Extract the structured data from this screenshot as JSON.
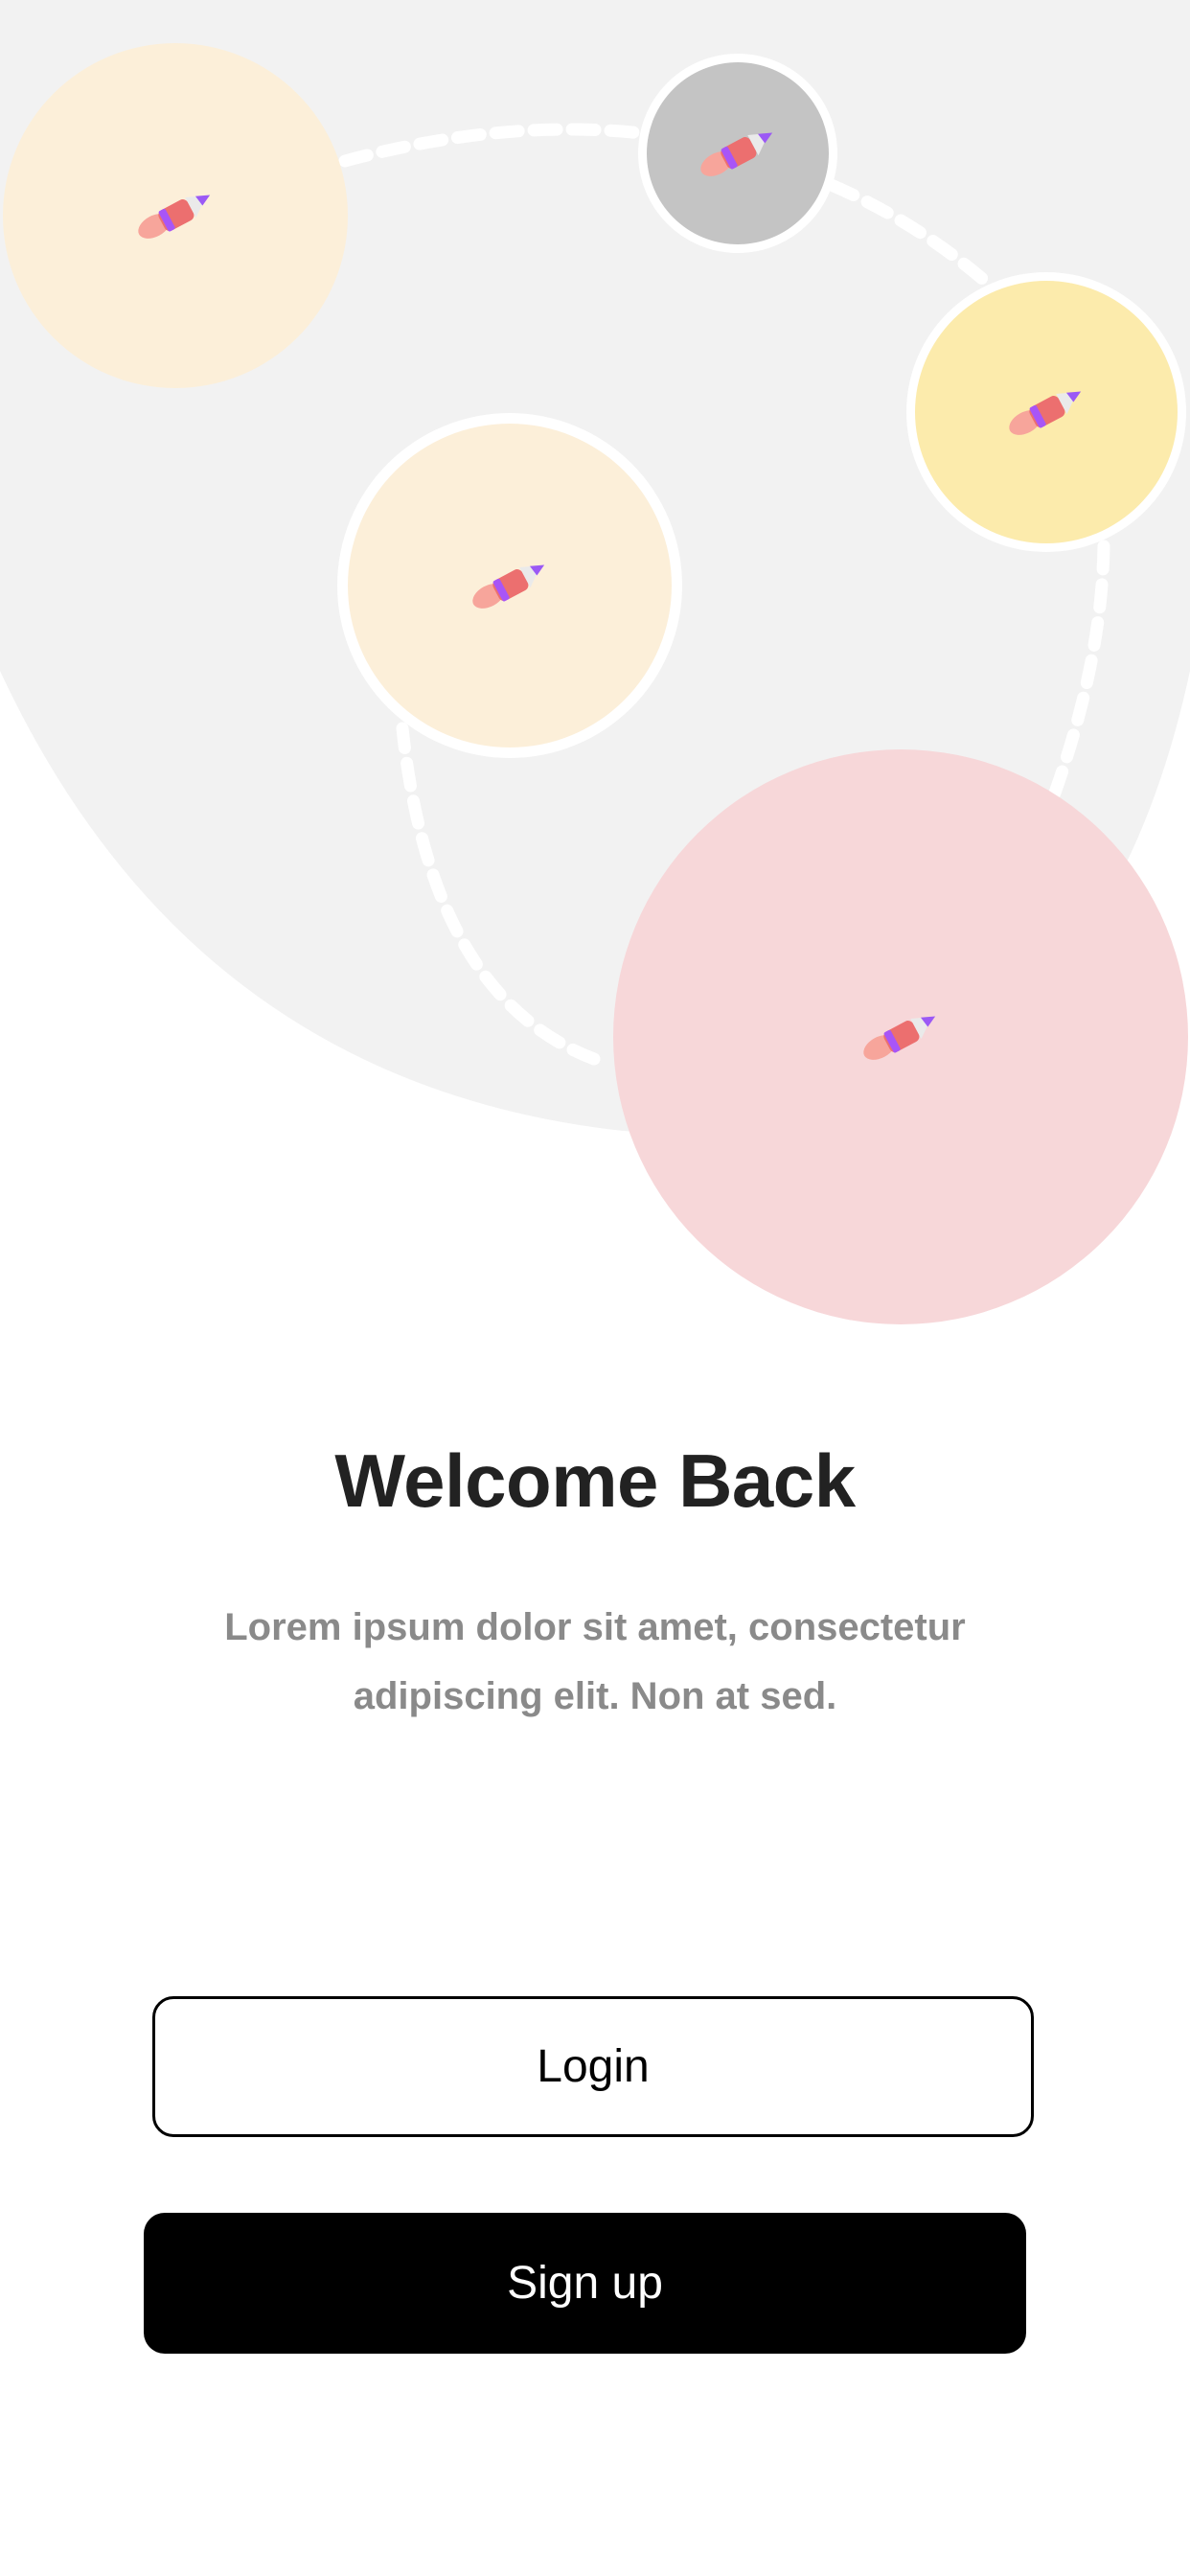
{
  "hero": {
    "illustration_icon": "rocket-icon",
    "colors": {
      "background_blob": "#f2f2f2",
      "bubble_cream": "#fcefd9",
      "bubble_grey": "#c4c4c4",
      "bubble_yellow": "#fcebac",
      "bubble_pink": "#f7d7d9",
      "ring": "#ffffff"
    }
  },
  "welcome": {
    "title": "Welcome Back",
    "subtitle": "Lorem ipsum dolor sit amet, consectetur adipiscing elit. Non at sed."
  },
  "actions": {
    "login_label": "Login",
    "signup_label": "Sign up"
  }
}
